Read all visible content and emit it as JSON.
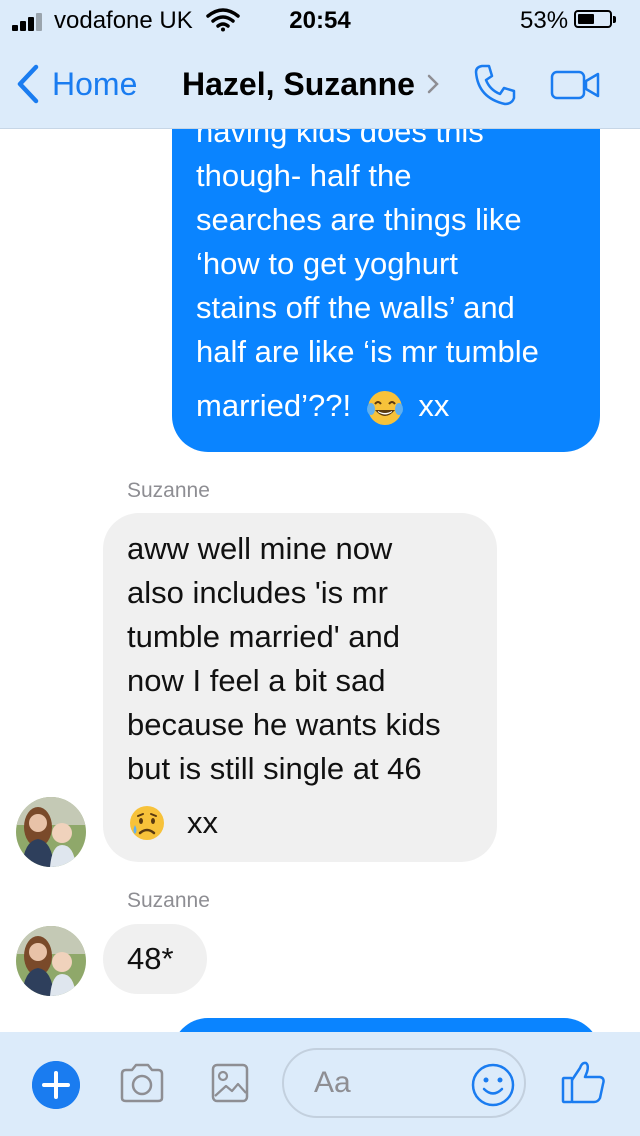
{
  "status_bar": {
    "carrier": "vodafone UK",
    "time": "20:54",
    "battery_percent": "53%",
    "battery_level": 0.53,
    "signal_bars": 3,
    "icons": [
      "signal-icon",
      "wifi-icon",
      "battery-icon"
    ]
  },
  "nav": {
    "back_label": "Home",
    "title": "Hazel, Suzanne",
    "icons": [
      "chevron-left-icon",
      "chevron-right-icon",
      "phone-icon",
      "video-camera-icon"
    ]
  },
  "messages": [
    {
      "direction": "outgoing",
      "lines": [
        "having kids does this",
        "though- half the",
        "searches are things like",
        "‘how to get yoghurt",
        "stains off the walls’ and",
        "half are like ‘is mr tumble",
        "married’??!"
      ],
      "emoji": "face-with-tears-of-joy",
      "suffix": "xx"
    },
    {
      "direction": "incoming",
      "sender": "Suzanne",
      "lines": [
        "aww well mine now",
        "also includes 'is mr",
        "tumble married' and",
        "now I feel a bit sad",
        "because he wants kids",
        "but is still single at 46"
      ],
      "emoji": "crying-face",
      "suffix": "xx"
    },
    {
      "direction": "incoming",
      "sender": "Suzanne",
      "text": "48*"
    }
  ],
  "composer": {
    "placeholder": "Aa",
    "icons": [
      "plus-icon",
      "camera-icon",
      "image-icon",
      "smiley-icon",
      "thumbs-up-icon"
    ]
  },
  "colors": {
    "accent": "#1a7cf0",
    "outgoing_bubble": "#0a84ff",
    "incoming_bubble": "#f0f0f0",
    "bar_background": "#dcebfa"
  }
}
